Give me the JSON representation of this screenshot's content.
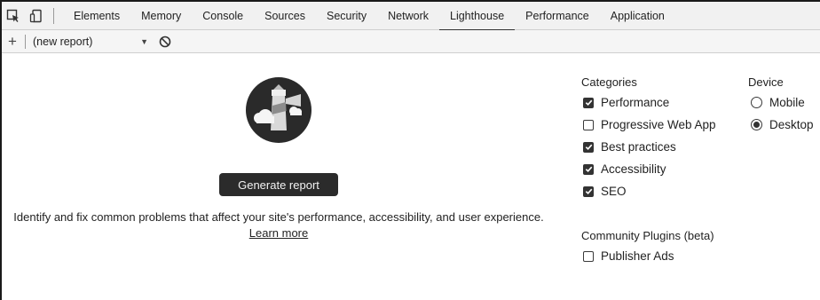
{
  "tabbar": {
    "tabs": [
      {
        "label": "Elements",
        "active": false
      },
      {
        "label": "Memory",
        "active": false
      },
      {
        "label": "Console",
        "active": false
      },
      {
        "label": "Sources",
        "active": false
      },
      {
        "label": "Security",
        "active": false
      },
      {
        "label": "Network",
        "active": false
      },
      {
        "label": "Lighthouse",
        "active": true
      },
      {
        "label": "Performance",
        "active": false
      },
      {
        "label": "Application",
        "active": false
      }
    ],
    "icons": [
      "inspect-element-icon",
      "device-toolbar-icon"
    ]
  },
  "toolbar": {
    "add_label": "+",
    "report_select_value": "(new report)",
    "icons": [
      "dropdown-arrow-icon",
      "clear-icon"
    ]
  },
  "main": {
    "logo_icon": "lighthouse-logo-icon",
    "generate_button": "Generate report",
    "description": "Identify and fix common problems that affect your site's performance, accessibility, and user experience.",
    "learn_more": "Learn more"
  },
  "categories": {
    "heading": "Categories",
    "items": [
      {
        "label": "Performance",
        "checked": true
      },
      {
        "label": "Progressive Web App",
        "checked": false
      },
      {
        "label": "Best practices",
        "checked": true
      },
      {
        "label": "Accessibility",
        "checked": true
      },
      {
        "label": "SEO",
        "checked": true
      }
    ]
  },
  "device": {
    "heading": "Device",
    "options": [
      {
        "label": "Mobile",
        "selected": false
      },
      {
        "label": "Desktop",
        "selected": true
      }
    ]
  },
  "plugins": {
    "heading": "Community Plugins (beta)",
    "items": [
      {
        "label": "Publisher Ads",
        "checked": false
      }
    ]
  },
  "colors": {
    "accent": "#333333",
    "button_bg": "#2b2b2b",
    "tabbar_bg": "#f1f1f1"
  }
}
